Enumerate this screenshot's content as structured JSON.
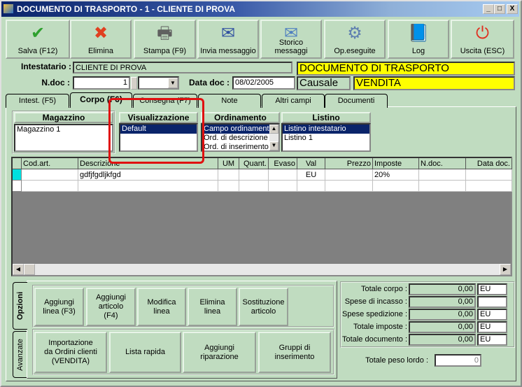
{
  "window": {
    "title": "DOCUMENTO DI TRASPORTO - 1  - CLIENTE DI PROVA",
    "minimize": "_",
    "maximize": "□",
    "close": "X"
  },
  "toolbar": [
    {
      "label": "Salva (F12)",
      "icon": "check-icon",
      "glyph": "✔",
      "color": "#2ea02e"
    },
    {
      "label": "Elimina",
      "icon": "delete-x-icon",
      "glyph": "✖",
      "color": "#e04020"
    },
    {
      "label": "Stampa (F9)",
      "icon": "printer-icon",
      "glyph": "🖶",
      "color": "#606060"
    },
    {
      "label": "Invia messaggio",
      "icon": "envelope-pen-icon",
      "glyph": "✉",
      "color": "#3050a0"
    },
    {
      "label": "Storico messaggi",
      "icon": "envelope-search-icon",
      "glyph": "✉",
      "color": "#5080c0"
    },
    {
      "label": "Op.eseguite",
      "icon": "gears-search-icon",
      "glyph": "⚙",
      "color": "#6080b0"
    },
    {
      "label": "Log",
      "icon": "book-search-icon",
      "glyph": "📘",
      "color": "#2050b0"
    },
    {
      "label": "Uscita (ESC)",
      "icon": "power-icon",
      "glyph": "⏻",
      "color": "#e03020"
    }
  ],
  "header": {
    "intestatario_label": "Intestatario :",
    "intestatario_value": "CLIENTE DI PROVA",
    "doc_type": "DOCUMENTO DI TRASPORTO",
    "ndoc_label": "N.doc :",
    "ndoc_value": "1",
    "series_value": "",
    "data_label": "Data doc :",
    "data_value": "08/02/2005",
    "causale_label": "Causale",
    "causale_value": "VENDITA"
  },
  "tabs": [
    "Intest. (F5)",
    "Corpo (F6)",
    "Consegna (F7)",
    "Note",
    "Altri campi",
    "Documenti"
  ],
  "groups": {
    "magazzino": {
      "title": "Magazzino",
      "items": [
        "Magazzino 1"
      ]
    },
    "visualizzazione": {
      "title": "Visualizzazione",
      "items": [
        "Default"
      ]
    },
    "ordinamento": {
      "title": "Ordinamento",
      "items": [
        "Campo ordinamento",
        "Ord. di descrizione",
        "Ord. di inserimento"
      ]
    },
    "listino": {
      "title": "Listino",
      "items": [
        "Listino intestatario",
        "Listino 1"
      ]
    }
  },
  "grid": {
    "columns": [
      "Cod.art.",
      "Descrizione",
      "UM",
      "Quant.",
      "Evaso",
      "Val",
      "Prezzo",
      "Imposte",
      "N.doc.",
      "Data doc."
    ],
    "rows": [
      [
        "",
        "gdfjfgdljkfgd",
        "",
        "",
        "",
        "EU",
        "",
        "20%",
        "",
        ""
      ],
      [
        "",
        "",
        "",
        "",
        "",
        "",
        "",
        "",
        "",
        ""
      ]
    ]
  },
  "side_tabs": [
    "Opzioni",
    "Avanzate"
  ],
  "options_row1": [
    "Aggiungi linea (F3)",
    "Aggiungi articolo (F4)",
    "Modifica linea",
    "Elimina linea",
    "Sostituzione articolo"
  ],
  "options_row2": [
    "Importazione da Ordini clienti (VENDITA)",
    "Lista rapida",
    "Aggiungi riparazione",
    "Gruppi di inserimento"
  ],
  "totals": [
    {
      "label": "Totale corpo :",
      "value": "0,00",
      "currency": "EU"
    },
    {
      "label": "Spese di incasso :",
      "value": "0,00",
      "currency": ""
    },
    {
      "label": "Spese spedizione :",
      "value": "0,00",
      "currency": "EU"
    },
    {
      "label": "Totale imposte :",
      "value": "0,00",
      "currency": "EU"
    },
    {
      "label": "Totale documento :",
      "value": "0,00",
      "currency": "EU"
    }
  ],
  "peso": {
    "label": "Totale peso lordo :",
    "value": "0"
  }
}
